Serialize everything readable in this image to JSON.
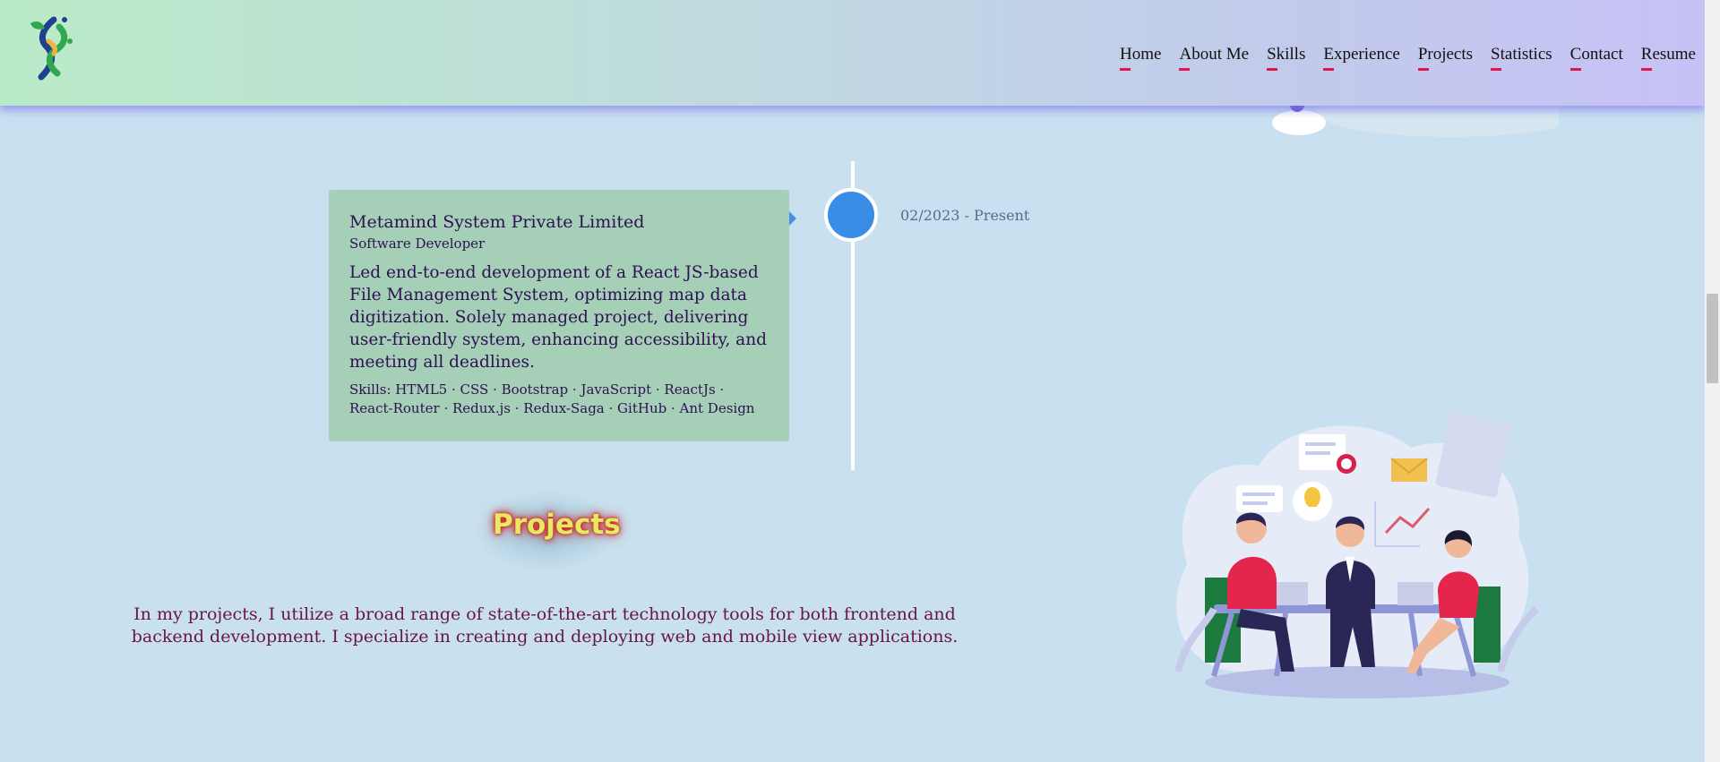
{
  "nav": {
    "items": [
      "Home",
      "About Me",
      "Skills",
      "Experience",
      "Projects",
      "Statistics",
      "Contact",
      "Resume"
    ]
  },
  "experience": {
    "company": "Metamind System Private Limited",
    "role": "Software Developer",
    "description": "Led end-to-end development of a React JS-based File Management System, optimizing map data digitization. Solely managed project, delivering user-friendly system, enhancing accessibility, and meeting all deadlines.",
    "skills": "Skills: HTML5 · CSS · Bootstrap · JavaScript · ReactJs · React-Router · Redux.js · Redux-Saga · GitHub · Ant Design",
    "date": "02/2023 - Present"
  },
  "projects": {
    "title": "Projects",
    "intro": "In my projects, I utilize a broad range of state-of-the-art technology tools for both frontend and backend development. I specialize in creating and deploying web and mobile view applications."
  },
  "colors": {
    "accent_underline": "#e0164f",
    "timeline_dot": "#3a8de6",
    "card_bg": "#a6cfb7",
    "page_bg": "#c8e0ef"
  },
  "icons": {
    "logo": "leaf-helix-logo-icon",
    "illustration": "team-meeting-illustration"
  }
}
